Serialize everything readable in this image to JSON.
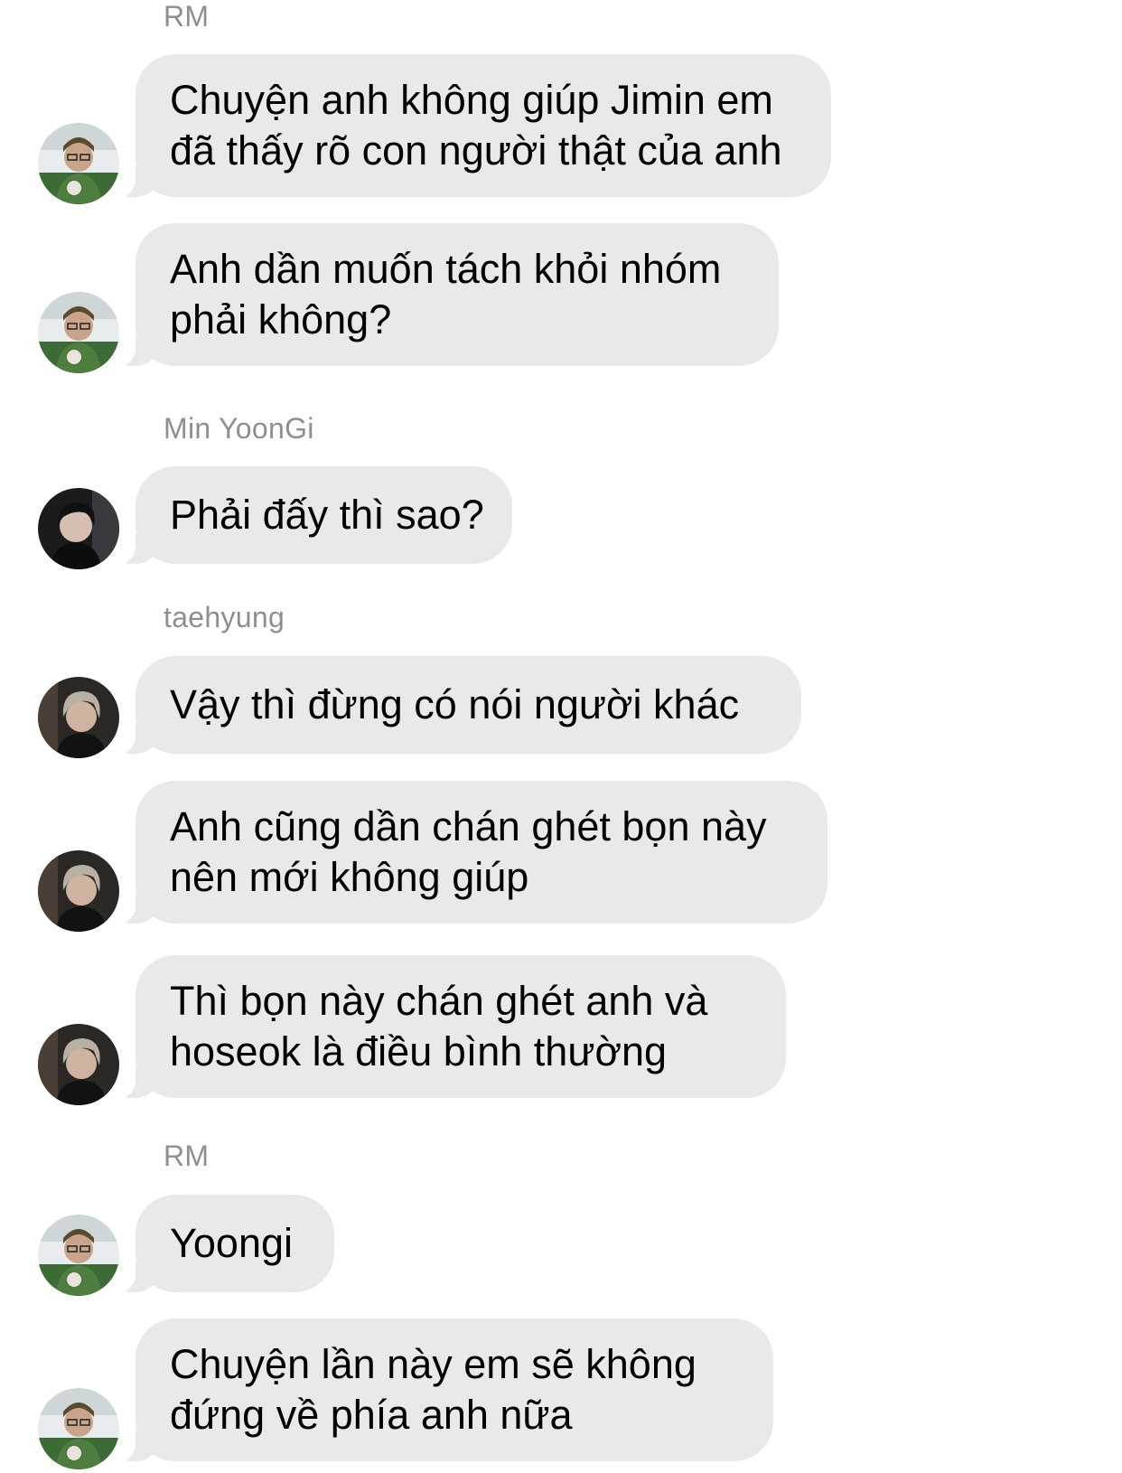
{
  "chat": {
    "groups": [
      {
        "sender": "RM",
        "avatar": "rm-avatar",
        "messages": [
          {
            "lines": [
              "Chuyện anh không giúp Jimin em",
              "đã thấy rõ con người thật của anh"
            ]
          },
          {
            "lines": [
              "Anh dần muốn tách khỏi nhóm",
              "phải không?"
            ]
          }
        ]
      },
      {
        "sender": "Min YoonGi",
        "avatar": "yoongi-avatar",
        "messages": [
          {
            "lines": [
              "Phải đấy thì sao?"
            ]
          }
        ]
      },
      {
        "sender": "taehyung",
        "avatar": "taehyung-avatar",
        "messages": [
          {
            "lines": [
              "Vậy thì đừng có nói người khác"
            ]
          },
          {
            "lines": [
              "Anh cũng dần chán ghét bọn này",
              "nên mới không giúp"
            ]
          },
          {
            "lines": [
              "Thì bọn này chán ghét anh và",
              "hoseok là điều bình thường"
            ]
          }
        ]
      },
      {
        "sender": "RM",
        "avatar": "rm-avatar",
        "messages": [
          {
            "lines": [
              "Yoongi"
            ]
          },
          {
            "lines": [
              "Chuyện lần này em sẽ không",
              "đứng về phía anh nữa"
            ]
          }
        ]
      }
    ]
  }
}
